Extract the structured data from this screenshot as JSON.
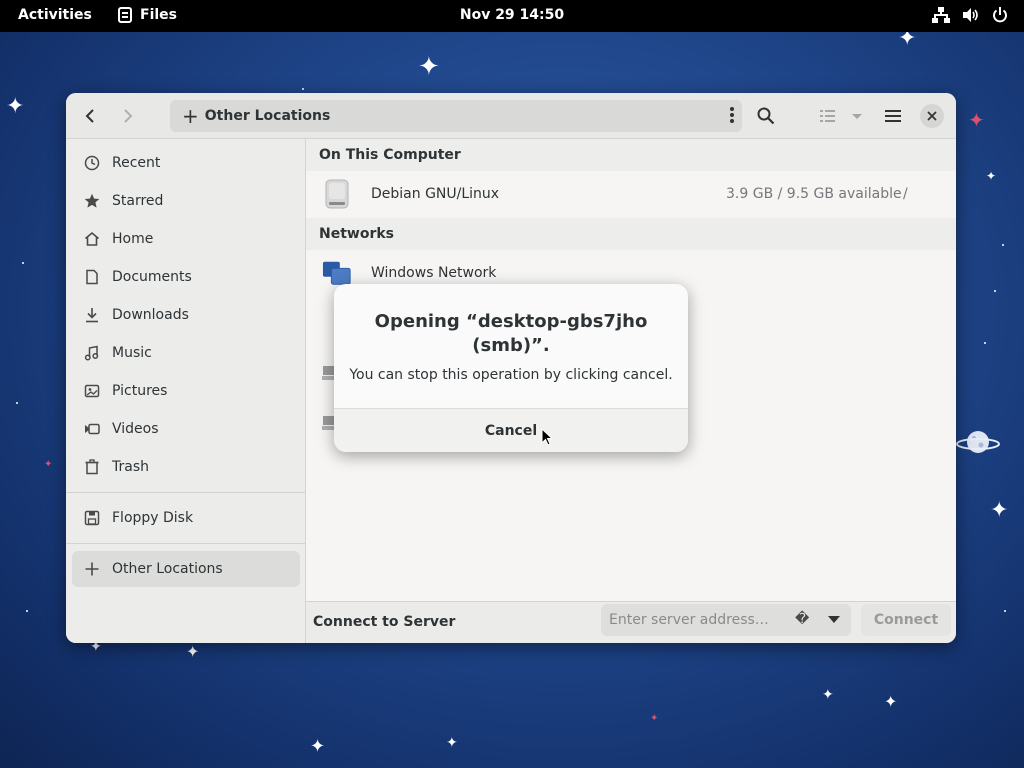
{
  "topbar": {
    "activities": "Activities",
    "app_name": "Files",
    "clock": "Nov 29  14:50",
    "tray_icons": [
      "network-icon",
      "volume-icon",
      "power-icon"
    ]
  },
  "window": {
    "path_label": "Other Locations",
    "icons": {
      "back": "chevron-left-icon",
      "forward": "chevron-right-icon",
      "search": "search-icon",
      "view": "list-view-icon",
      "menu": "hamburger-menu-icon",
      "close": "close-icon"
    }
  },
  "sidebar": {
    "items": [
      {
        "label": "Recent",
        "icon": "clock-icon"
      },
      {
        "label": "Starred",
        "icon": "star-icon"
      },
      {
        "label": "Home",
        "icon": "home-icon"
      },
      {
        "label": "Documents",
        "icon": "document-icon"
      },
      {
        "label": "Downloads",
        "icon": "download-icon"
      },
      {
        "label": "Music",
        "icon": "music-icon"
      },
      {
        "label": "Pictures",
        "icon": "picture-icon"
      },
      {
        "label": "Videos",
        "icon": "video-icon"
      },
      {
        "label": "Trash",
        "icon": "trash-icon"
      }
    ],
    "devices": [
      {
        "label": "Floppy Disk",
        "icon": "floppy-icon"
      }
    ],
    "other_locations": {
      "label": "Other Locations",
      "icon": "plus-icon",
      "active": true
    }
  },
  "content": {
    "sections": [
      {
        "title": "On This Computer",
        "rows": [
          {
            "name": "Debian GNU/Linux",
            "info": "3.9 GB / 9.5 GB available",
            "mount": "/",
            "icon": "drive-icon"
          }
        ]
      },
      {
        "title": "Networks",
        "rows": [
          {
            "name": "Windows Network",
            "icon": "network-folder-icon"
          }
        ]
      }
    ]
  },
  "bottombar": {
    "title": "Connect to Server",
    "placeholder": "Enter server address…",
    "help_icon": "�",
    "connect_label": "Connect"
  },
  "dialog": {
    "title": "Opening “desktop-gbs7jho (smb)”.",
    "message": "You can stop this operation by clicking cancel.",
    "cancel_label": "Cancel"
  },
  "colors": {
    "topbar": "#000000",
    "window_bg": "#f6f5f4",
    "sidebar_bg": "#ececeb",
    "accent_blue": "#2a5aa6",
    "desktop": "#1f4589"
  }
}
